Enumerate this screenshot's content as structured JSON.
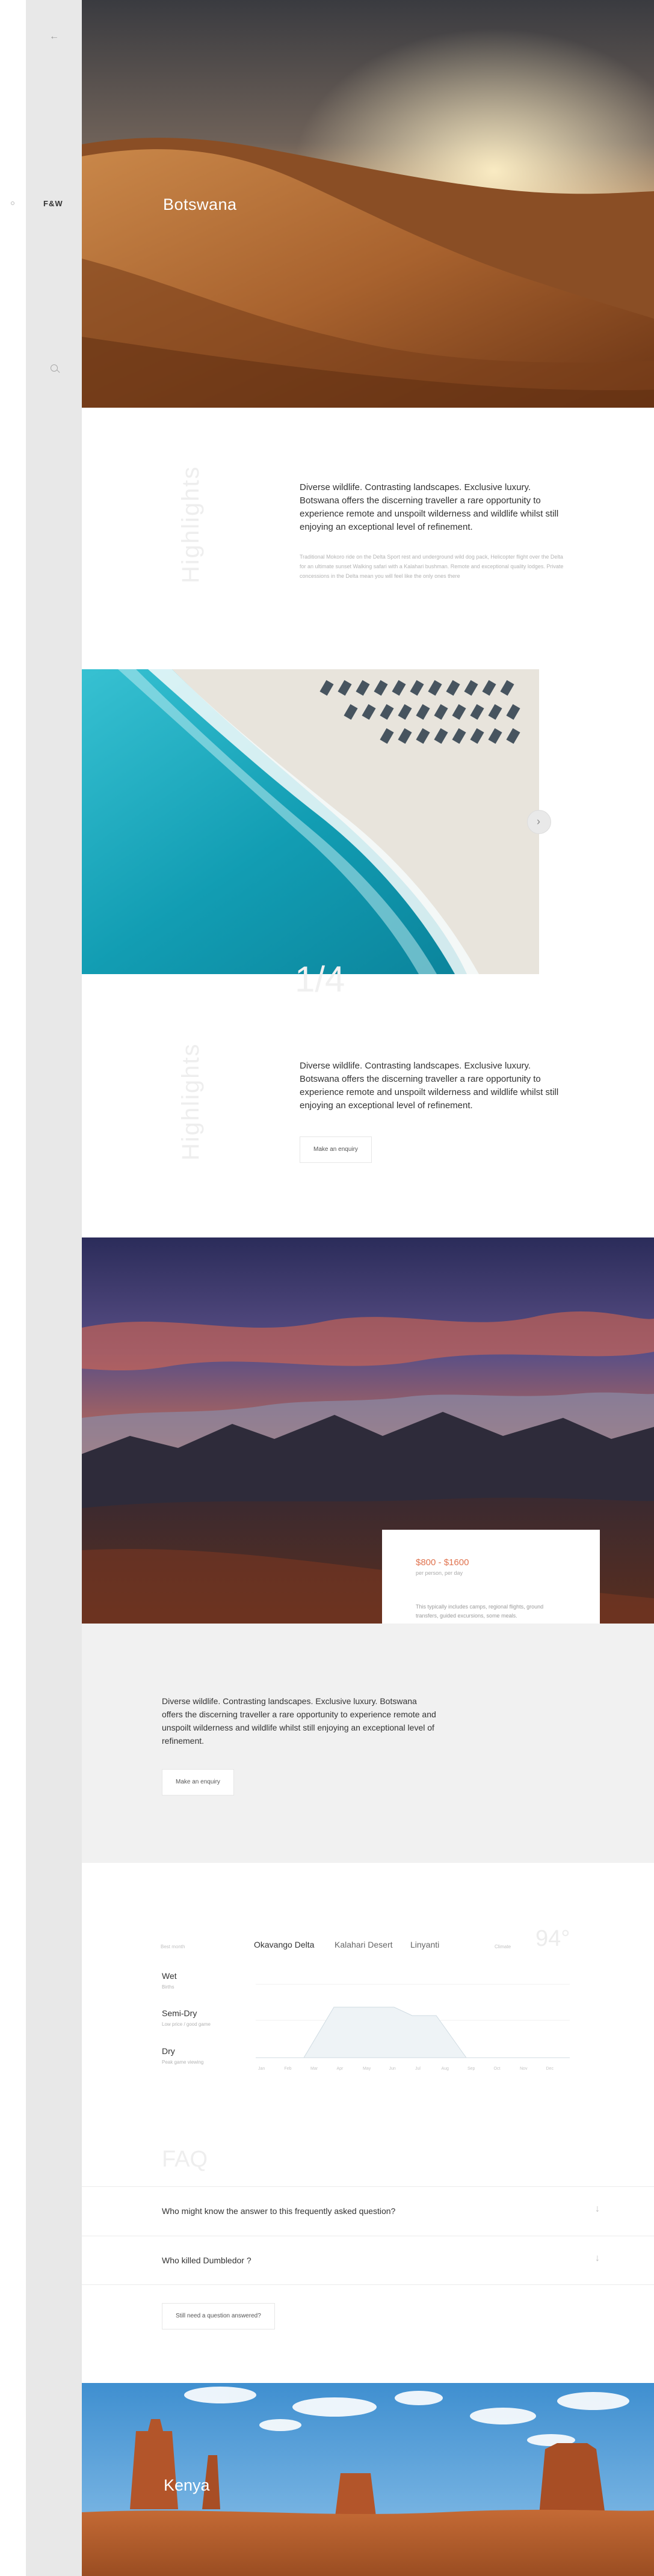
{
  "rail": {
    "back_icon": "arrow-left-icon",
    "logo": "F&W",
    "search_icon": "search-icon"
  },
  "hero": {
    "title": "Botswana"
  },
  "highlights_1": {
    "vertical_label": "Highlights",
    "intro": "Diverse wildlife. Contrasting landscapes. Exclusive luxury. Botswana offers the discerning traveller a rare opportunity to experience remote and unspoilt wilderness and wildlife whilst still enjoying an exceptional level of refinement.",
    "body": "Traditional Mokoro ride on the Delta Sport rest and underground wild dog pack, Helicopter flight over the Delta for an ultimate sunset Walking safari with a Kalahari bushman. Remote and exceptional quality lodges. Private concessions in the Delta mean you will feel like the only ones there"
  },
  "gallery": {
    "counter": "1/4",
    "next_icon": "chevron-right-icon"
  },
  "highlights_2": {
    "vertical_label": "Highlights",
    "intro": "Diverse wildlife. Contrasting landscapes. Exclusive luxury. Botswana offers the discerning traveller a rare opportunity to experience remote and unspoilt wilderness and wildlife whilst still enjoying an exceptional level of refinement.",
    "button": "Make an enquiry"
  },
  "price_card": {
    "price": "$800 - $1600",
    "sub": "per person, per day",
    "desc": "This typically includes camps, regional flights, ground transfers, guided excursions, some meals."
  },
  "band": {
    "text": "Diverse wildlife. Contrasting landscapes. Exclusive luxury. Botswana offers the discerning traveller a rare opportunity to experience remote and unspoilt wilderness and wildlife whilst still enjoying an exceptional level of refinement.",
    "button": "Make an enquiry"
  },
  "climate": {
    "month_label": "Best month",
    "regions": [
      "Okavango Delta",
      "Kalahari Desert",
      "Linyanti"
    ],
    "temp_label": "Climate",
    "temp": "94°",
    "seasons": [
      {
        "name": "Wet",
        "sub": "Births"
      },
      {
        "name": "Semi-Dry",
        "sub": "Low price / good game"
      },
      {
        "name": "Dry",
        "sub": "Peak game viewing"
      }
    ],
    "months": [
      "Jan",
      "Feb",
      "Mar",
      "Apr",
      "May",
      "Jun",
      "Jul",
      "Aug",
      "Sep",
      "Oct",
      "Nov",
      "Dec"
    ],
    "colors": {
      "fill": "#eef3f6",
      "stroke": "#cfdbe2"
    }
  },
  "faq": {
    "title": "FAQ",
    "questions": [
      "Who might know the answer to this frequently asked question?",
      "Who killed Dumbledor ?"
    ],
    "button": "Still need a question answered?",
    "arrow_icon": "arrow-down-icon"
  },
  "kenya": {
    "title": "Kenya"
  },
  "colors": {
    "accent": "#e0734f",
    "rail": "#e8e8e8",
    "band": "#f1f1f1"
  }
}
